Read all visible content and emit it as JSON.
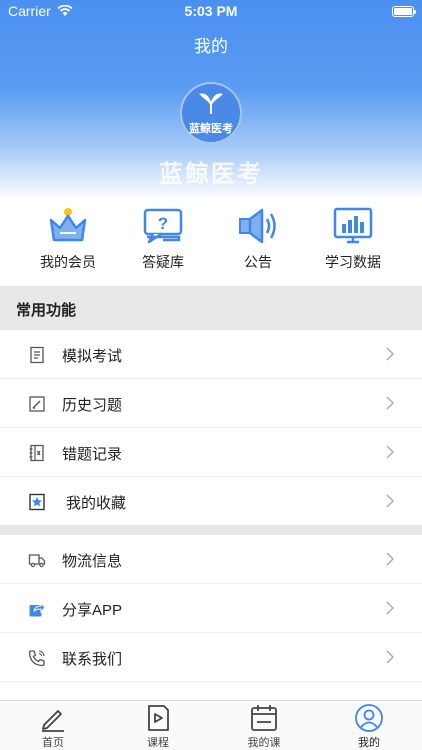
{
  "status_bar": {
    "carrier": "Carrier",
    "time": "5:03 PM"
  },
  "header": {
    "title": "我的"
  },
  "brand": {
    "logo_text": "蓝鲸医考",
    "name": "蓝鲸医考"
  },
  "quick_actions": [
    {
      "label": "我的会员",
      "icon": "crown-icon"
    },
    {
      "label": "答疑库",
      "icon": "question-bubble-icon"
    },
    {
      "label": "公告",
      "icon": "speaker-icon"
    },
    {
      "label": "学习数据",
      "icon": "bar-chart-monitor-icon"
    }
  ],
  "section": {
    "title": "常用功能"
  },
  "menu_group1": [
    {
      "label": "模拟考试",
      "icon": "document-icon"
    },
    {
      "label": "历史习题",
      "icon": "edit-icon"
    },
    {
      "label": "错题记录",
      "icon": "notebook-icon"
    },
    {
      "label": "我的收藏",
      "icon": "star-bookmark-icon"
    }
  ],
  "menu_group2": [
    {
      "label": "物流信息",
      "icon": "truck-icon"
    },
    {
      "label": "分享APP",
      "icon": "share-icon"
    },
    {
      "label": "联系我们",
      "icon": "phone-icon"
    }
  ],
  "tabbar": [
    {
      "label": "首页",
      "icon": "pencil-icon"
    },
    {
      "label": "课程",
      "icon": "play-book-icon"
    },
    {
      "label": "我的课",
      "icon": "calendar-icon"
    },
    {
      "label": "我的",
      "icon": "user-icon",
      "active": true
    }
  ],
  "colors": {
    "primary": "#4a90ef",
    "icon_blue": "#3f87e8",
    "divider": "#e8e8e8"
  }
}
